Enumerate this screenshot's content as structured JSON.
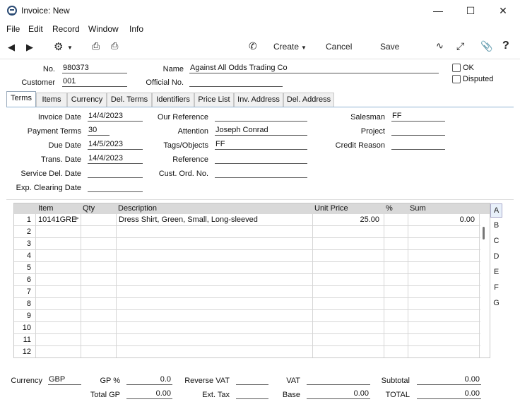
{
  "window": {
    "title": "Invoice: New"
  },
  "menu": [
    "File",
    "Edit",
    "Record",
    "Window",
    "Info"
  ],
  "toolbar": {
    "create": "Create",
    "cancel": "Cancel",
    "save": "Save",
    "help": "?"
  },
  "header": {
    "no_label": "No.",
    "no_value": "980373",
    "name_label": "Name",
    "name_value": "Against All Odds Trading Co",
    "customer_label": "Customer",
    "customer_value": "001",
    "official_label": "Official No.",
    "official_value": "",
    "ok_label": "OK",
    "disputed_label": "Disputed"
  },
  "tabs": [
    "Terms",
    "Items",
    "Currency",
    "Del. Terms",
    "Identifiers",
    "Price List",
    "Inv. Address",
    "Del. Address"
  ],
  "terms": {
    "invoice_date_label": "Invoice Date",
    "invoice_date": "14/4/2023",
    "payment_terms_label": "Payment Terms",
    "payment_terms": "30",
    "due_date_label": "Due Date",
    "due_date": "14/5/2023",
    "trans_date_label": "Trans. Date",
    "trans_date": "14/4/2023",
    "service_del_label": "Service Del. Date",
    "service_del": "",
    "exp_clearing_label": "Exp. Clearing Date",
    "exp_clearing": "",
    "our_ref_label": "Our Reference",
    "our_ref": "",
    "attention_label": "Attention",
    "attention": "Joseph Conrad",
    "tags_label": "Tags/Objects",
    "tags": "FF",
    "reference_label": "Reference",
    "reference": "",
    "cust_ord_label": "Cust. Ord. No.",
    "cust_ord": "",
    "salesman_label": "Salesman",
    "salesman": "FF",
    "project_label": "Project",
    "project": "",
    "credit_reason_label": "Credit Reason",
    "credit_reason": ""
  },
  "grid": {
    "columns": [
      "Item",
      "Qty",
      "Description",
      "Unit Price",
      "%",
      "Sum"
    ],
    "rows": [
      {
        "n": "1",
        "item": "10141GRE",
        "qty": "",
        "desc": "Dress Shirt, Green, Small, Long-sleeved",
        "price": "25.00",
        "pct": "",
        "sum": "0.00"
      },
      {
        "n": "2"
      },
      {
        "n": "3"
      },
      {
        "n": "4"
      },
      {
        "n": "5"
      },
      {
        "n": "6"
      },
      {
        "n": "7"
      },
      {
        "n": "8"
      },
      {
        "n": "9"
      },
      {
        "n": "10"
      },
      {
        "n": "11"
      },
      {
        "n": "12"
      }
    ],
    "side_tabs": [
      "A",
      "B",
      "C",
      "D",
      "E",
      "F",
      "G"
    ]
  },
  "footer": {
    "currency_label": "Currency",
    "currency": "GBP",
    "gp_pct_label": "GP %",
    "gp_pct": "0.0",
    "total_gp_label": "Total GP",
    "total_gp": "0.00",
    "reverse_vat_label": "Reverse VAT",
    "reverse_vat": "",
    "ext_tax_label": "Ext. Tax",
    "ext_tax": "",
    "vat_label": "VAT",
    "vat": "",
    "base_label": "Base",
    "base": "0.00",
    "subtotal_label": "Subtotal",
    "subtotal": "0.00",
    "total_label": "TOTAL",
    "total": "0.00"
  }
}
